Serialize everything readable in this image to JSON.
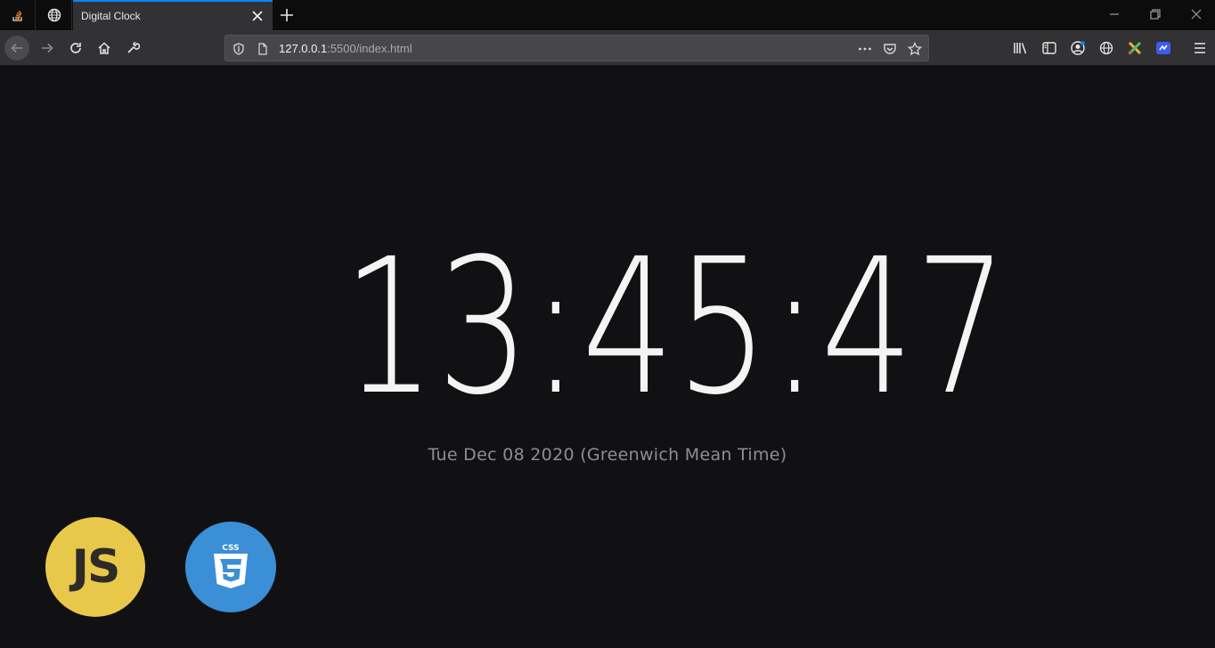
{
  "browser": {
    "tab": {
      "title": "Digital Clock"
    },
    "url": {
      "host": "127.0.0.1",
      "rest": ":5500/index.html"
    },
    "accent_color": "#0a84ff"
  },
  "page": {
    "clock": {
      "time": "13:45:47"
    },
    "date": "Tue Dec 08 2020 (Greenwich Mean Time)",
    "logos": [
      {
        "name": "javascript-logo",
        "text": "JS",
        "color": "#e8c84a"
      },
      {
        "name": "css3-logo",
        "text": "CSS",
        "color": "#3a8fd6"
      }
    ],
    "background_color": "#111113",
    "text_color": "#f4f4f4"
  }
}
